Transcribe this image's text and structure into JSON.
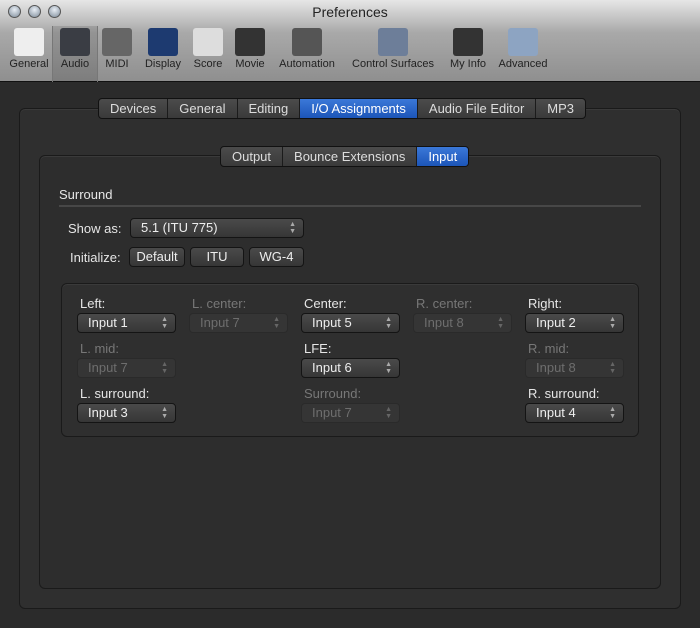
{
  "window": {
    "title": "Preferences"
  },
  "toolbar": [
    "General",
    "Audio",
    "MIDI",
    "Display",
    "Score",
    "Movie",
    "Automation",
    "Control Surfaces",
    "My Info",
    "Advanced"
  ],
  "tabs": [
    "Devices",
    "General",
    "Editing",
    "I/O Assignments",
    "Audio File Editor",
    "MP3"
  ],
  "subtabs": [
    "Output",
    "Bounce Extensions",
    "Input"
  ],
  "surround": {
    "heading": "Surround",
    "show_as_label": "Show as:",
    "show_as_value": "5.1 (ITU 775)",
    "initialize_label": "Initialize:",
    "buttons": [
      "Default",
      "ITU",
      "WG-4"
    ]
  },
  "channels": [
    {
      "label": "Left:",
      "value": "Input 1",
      "enabled": true
    },
    {
      "label": "L. center:",
      "value": "Input 7",
      "enabled": false
    },
    {
      "label": "Center:",
      "value": "Input 5",
      "enabled": true
    },
    {
      "label": "R. center:",
      "value": "Input 8",
      "enabled": false
    },
    {
      "label": "Right:",
      "value": "Input 2",
      "enabled": true
    },
    {
      "label": "L. mid:",
      "value": "Input 7",
      "enabled": false
    },
    {
      "label": "LFE:",
      "value": "Input 6",
      "enabled": true
    },
    {
      "label": "R. mid:",
      "value": "Input 8",
      "enabled": false
    },
    {
      "label": "L. surround:",
      "value": "Input 3",
      "enabled": true
    },
    {
      "label": "Surround:",
      "value": "Input 7",
      "enabled": false
    },
    {
      "label": "R. surround:",
      "value": "Input 4",
      "enabled": true
    }
  ]
}
